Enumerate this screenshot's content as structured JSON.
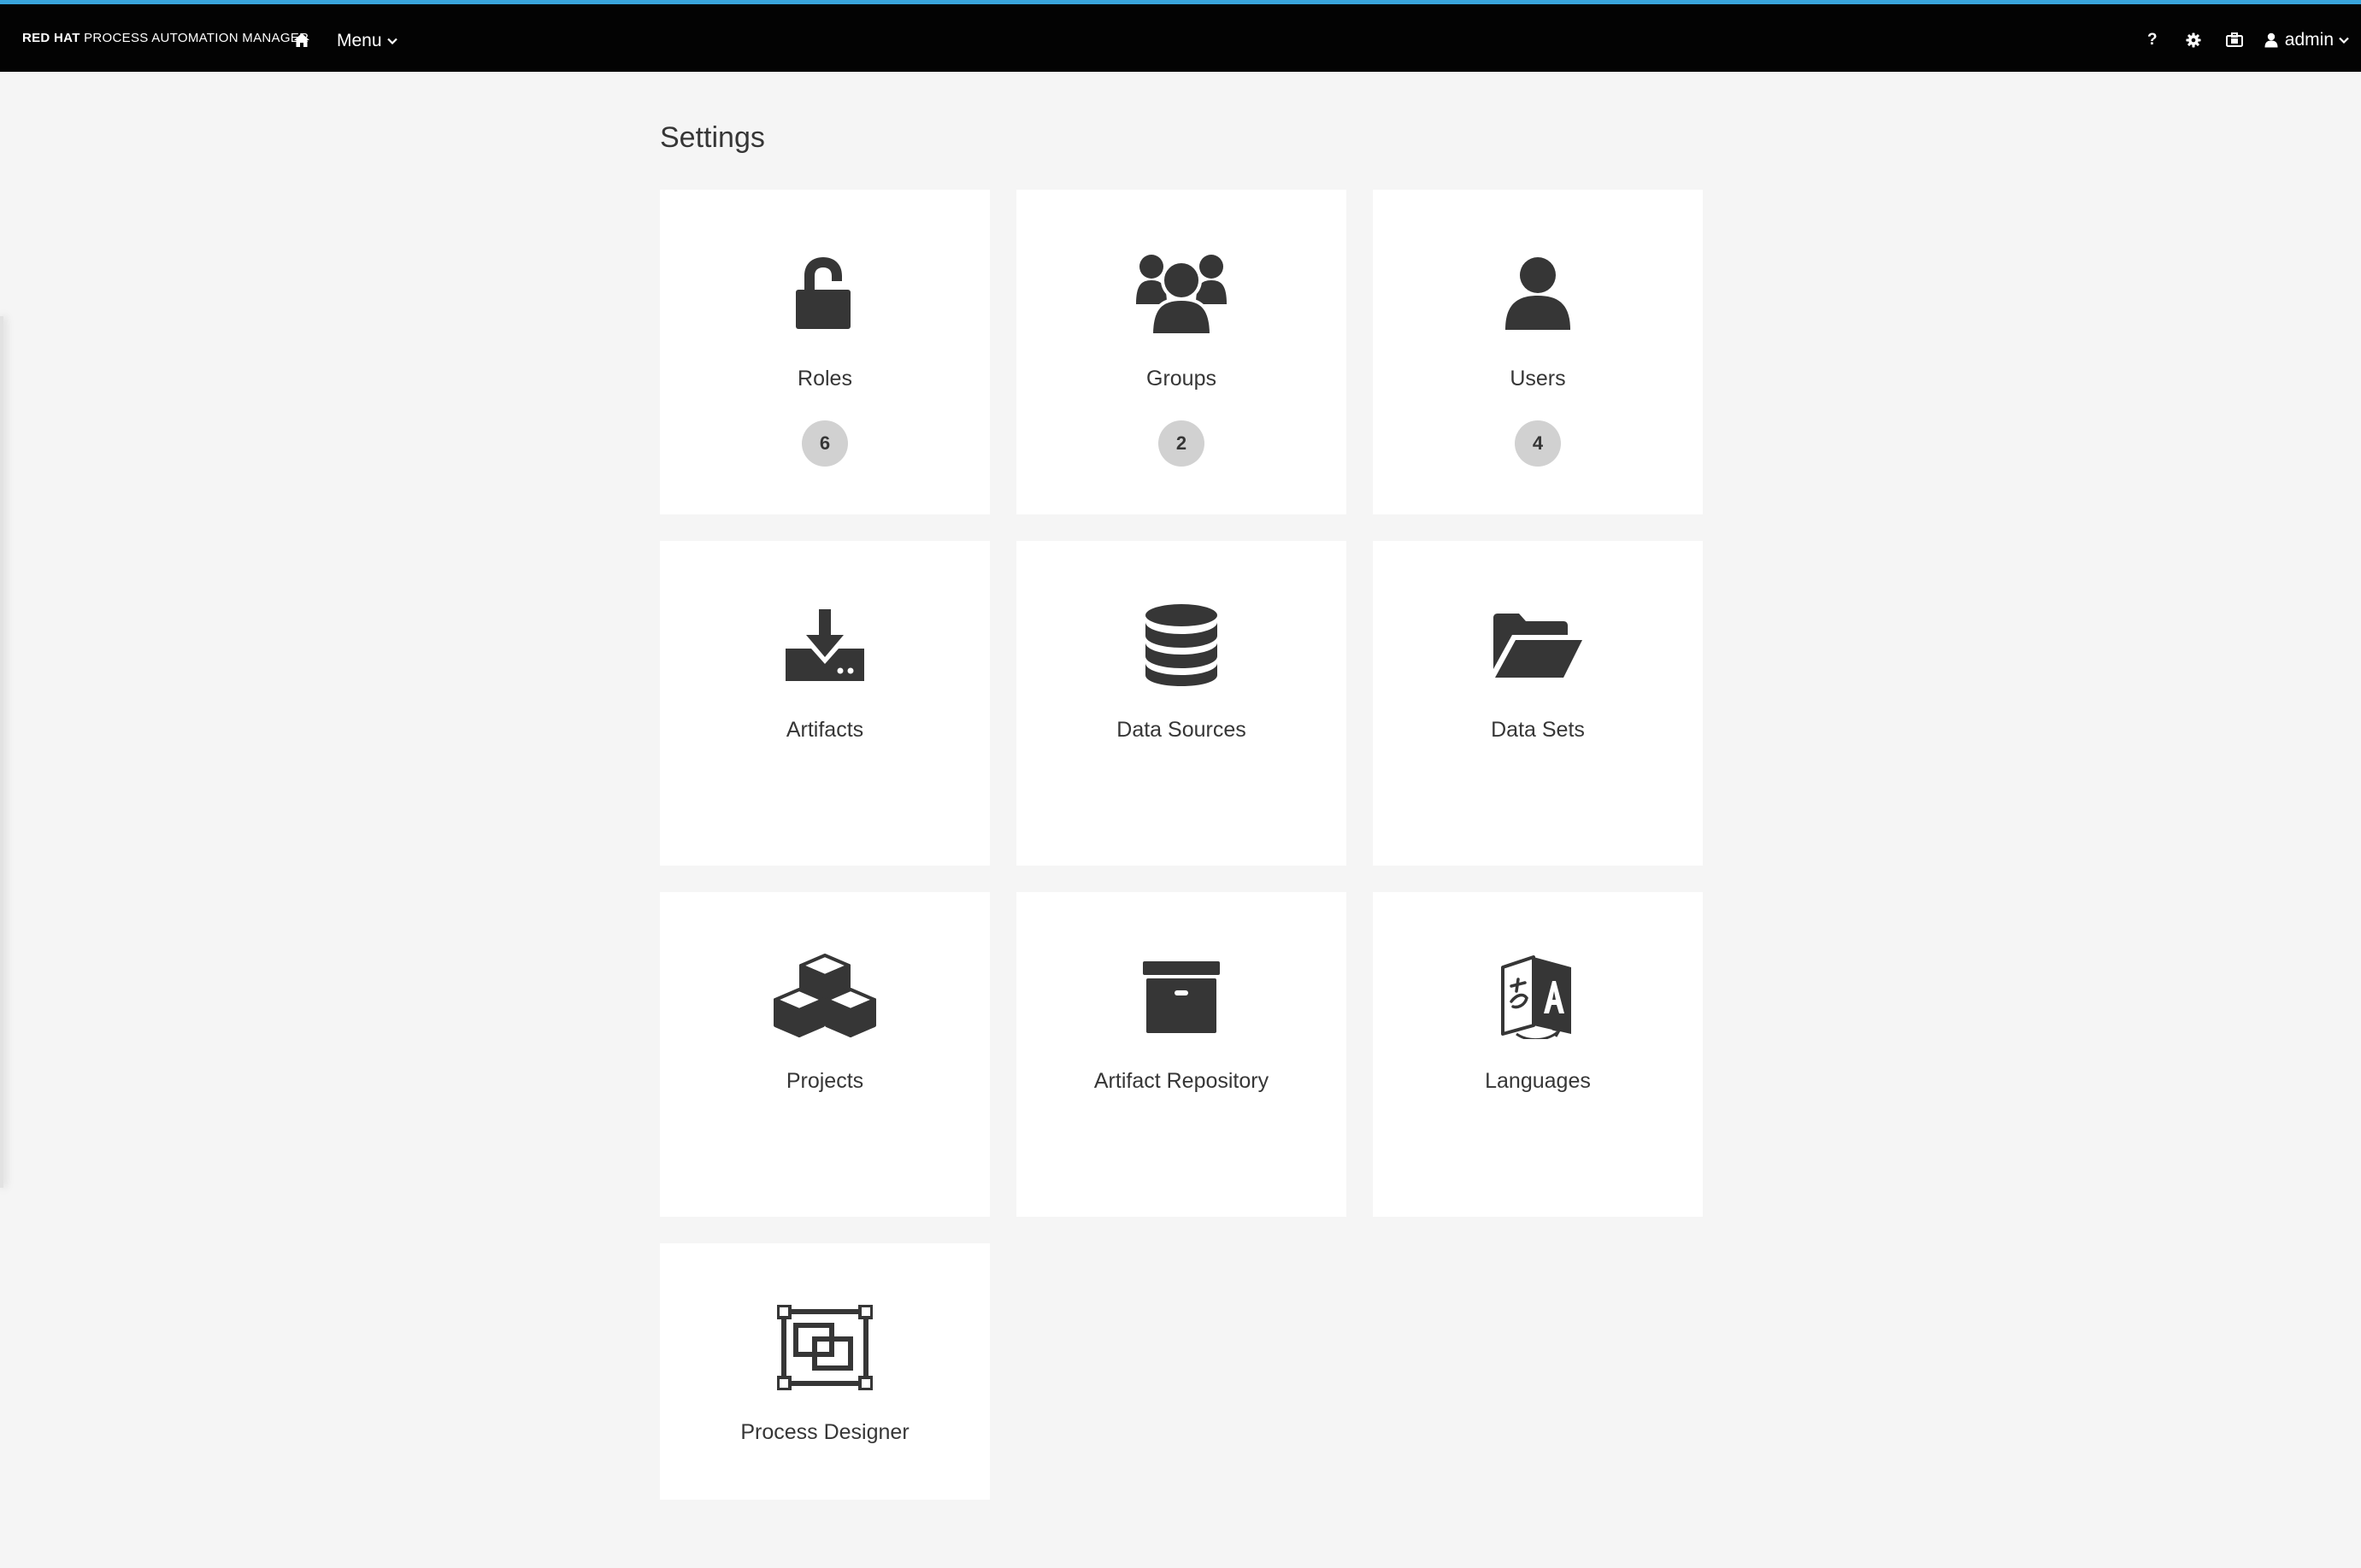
{
  "navbar": {
    "brand_strong": "RED HAT",
    "brand_rest": "PROCESS AUTOMATION MANAGER",
    "home_icon": "home-icon",
    "menu_label": "Menu",
    "help_label": "?",
    "user_label": "admin",
    "background": "#030303",
    "accent": "#39a5dc"
  },
  "page": {
    "title": "Settings"
  },
  "tiles": [
    {
      "label": "Roles",
      "icon": "unlock-icon",
      "badge": "6"
    },
    {
      "label": "Groups",
      "icon": "users-group-icon",
      "badge": "2"
    },
    {
      "label": "Users",
      "icon": "user-icon",
      "badge": "4"
    },
    {
      "label": "Artifacts",
      "icon": "download-drive-icon"
    },
    {
      "label": "Data Sources",
      "icon": "database-icon"
    },
    {
      "label": "Data Sets",
      "icon": "folder-open-icon"
    },
    {
      "label": "Projects",
      "icon": "cubes-icon"
    },
    {
      "label": "Artifact Repository",
      "icon": "archive-box-icon"
    },
    {
      "label": "Languages",
      "icon": "language-icon"
    },
    {
      "label": "Process Designer",
      "icon": "process-designer-icon"
    }
  ]
}
